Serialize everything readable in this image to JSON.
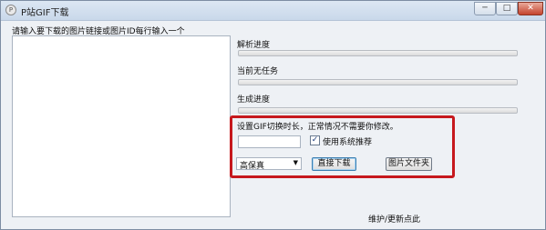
{
  "window": {
    "title": "P站GIF下载",
    "icon": "app-icon",
    "controls": {
      "minimize": "─",
      "maximize": "□",
      "close": "✕"
    }
  },
  "left": {
    "prompt": "请输入要下载的图片链接或图片ID每行输入一个",
    "urls_value": ""
  },
  "right": {
    "parse_label": "解析进度",
    "status_label": "当前无任务",
    "generate_label": "生成进度",
    "progress": {
      "parse": 0,
      "status": 0,
      "generate": 0
    },
    "duration_hint": "设置GIF切换时长，正常情况不需要你修改。",
    "duration_value": "",
    "use_system_label": "使用系统推荐",
    "use_system_checked": "✓",
    "quality_selected": "高保真",
    "download_button": "直接下载",
    "folder_button": "图片文件夹",
    "maintenance_link": "维护/更新点此"
  },
  "colors": {
    "highlight_box": "#c6181d",
    "progress_fill": "#37b44a"
  }
}
